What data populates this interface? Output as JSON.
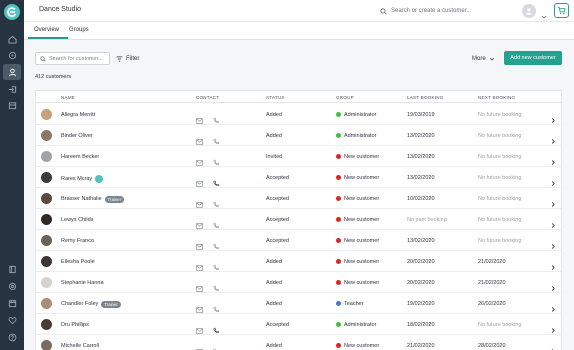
{
  "app": {
    "title": "Dance Studio"
  },
  "header": {
    "search_placeholder": "Search or create a customer..."
  },
  "tabs": [
    {
      "label": "Overview",
      "active": true
    },
    {
      "label": "Groups",
      "active": false
    }
  ],
  "toolbar": {
    "search_placeholder": "Search for customer...",
    "filter_label": "Filter",
    "more_label": "More",
    "add_label": "Add new customer"
  },
  "summary": {
    "count_text": "412 customers"
  },
  "table": {
    "columns": [
      "NAME",
      "CONTACT",
      "STATUS",
      "GROUP",
      "LAST BOOKING",
      "NEXT BOOKING"
    ],
    "rows": [
      {
        "name": "Allegra Merritt",
        "status": "Added",
        "group": "Administrator",
        "group_color": "#3cc13b",
        "last_booking": "19/03/2019",
        "next_booking": "No future booking",
        "last_muted": false,
        "next_muted": true,
        "avatar_color": "#c8a27a",
        "tag": "",
        "logo_badge": false,
        "phone_active": false
      },
      {
        "name": "Binder Oliver",
        "status": "Added",
        "group": "Administrator",
        "group_color": "#3cc13b",
        "last_booking": "13/02/2020",
        "next_booking": "No future booking",
        "last_muted": false,
        "next_muted": true,
        "avatar_color": "#8d7766",
        "tag": "",
        "logo_badge": false,
        "phone_active": false
      },
      {
        "name": "Hareem Becker",
        "status": "Invited",
        "group": "New customer",
        "group_color": "#e02424",
        "last_booking": "13/02/2020",
        "next_booking": "No future booking",
        "last_muted": false,
        "next_muted": true,
        "avatar_color": "#a0a4a8",
        "tag": "",
        "logo_badge": false,
        "phone_active": false
      },
      {
        "name": "Rares Mcray",
        "status": "Accepted",
        "group": "New customer",
        "group_color": "#e02424",
        "last_booking": "13/02/2020",
        "next_booking": "No future booking",
        "last_muted": false,
        "next_muted": true,
        "avatar_color": "#3b3b3b",
        "tag": "",
        "logo_badge": true,
        "phone_active": true
      },
      {
        "name": "Brasser Nathalie",
        "status": "Accepted",
        "group": "New customer",
        "group_color": "#e02424",
        "last_booking": "10/02/2020",
        "next_booking": "No future booking",
        "last_muted": false,
        "next_muted": true,
        "avatar_color": "#5a4a42",
        "tag": "Trainer",
        "logo_badge": false,
        "phone_active": false
      },
      {
        "name": "Lewys Childs",
        "status": "Accepted",
        "group": "New customer",
        "group_color": "#e02424",
        "last_booking": "No past booking",
        "next_booking": "No future booking",
        "last_muted": true,
        "next_muted": true,
        "avatar_color": "#2f2a28",
        "tag": "",
        "logo_badge": false,
        "phone_active": false
      },
      {
        "name": "Remy Franco",
        "status": "Accepted",
        "group": "New customer",
        "group_color": "#e02424",
        "last_booking": "13/02/2020",
        "next_booking": "No future booking",
        "last_muted": false,
        "next_muted": true,
        "avatar_color": "#6d6055",
        "tag": "",
        "logo_badge": false,
        "phone_active": false
      },
      {
        "name": "Ellesha Poole",
        "status": "Added",
        "group": "New customer",
        "group_color": "#e02424",
        "last_booking": "20/02/2020",
        "next_booking": "21/02/2020",
        "last_muted": false,
        "next_muted": false,
        "avatar_color": "#3e3632",
        "tag": "",
        "logo_badge": false,
        "phone_active": false
      },
      {
        "name": "Stephanie Hanna",
        "status": "Added",
        "group": "New customer",
        "group_color": "#e02424",
        "last_booking": "20/02/2020",
        "next_booking": "21/02/2020",
        "last_muted": false,
        "next_muted": false,
        "avatar_color": "#d6d2cd",
        "tag": "",
        "logo_badge": false,
        "phone_active": false
      },
      {
        "name": "Chandler Foley",
        "status": "Added",
        "group": "Teacher",
        "group_color": "#3d7bd0",
        "last_booking": "19/02/2020",
        "next_booking": "26/02/2020",
        "last_muted": false,
        "next_muted": false,
        "avatar_color": "#a98d78",
        "tag": "Trainer",
        "logo_badge": false,
        "phone_active": false
      },
      {
        "name": "Dru Phillips",
        "status": "Accepted",
        "group": "Administrator",
        "group_color": "#3cc13b",
        "last_booking": "18/02/2020",
        "next_booking": "No future booking",
        "last_muted": false,
        "next_muted": true,
        "avatar_color": "#4a3c35",
        "tag": "",
        "logo_badge": false,
        "phone_active": true
      },
      {
        "name": "Michelle Carroll",
        "status": "Added",
        "group": "New customer",
        "group_color": "#e02424",
        "last_booking": "21/02/2020",
        "next_booking": "28/02/2020",
        "last_muted": false,
        "next_muted": false,
        "avatar_color": "#7a6a60",
        "tag": "",
        "logo_badge": false,
        "phone_active": false
      }
    ]
  }
}
